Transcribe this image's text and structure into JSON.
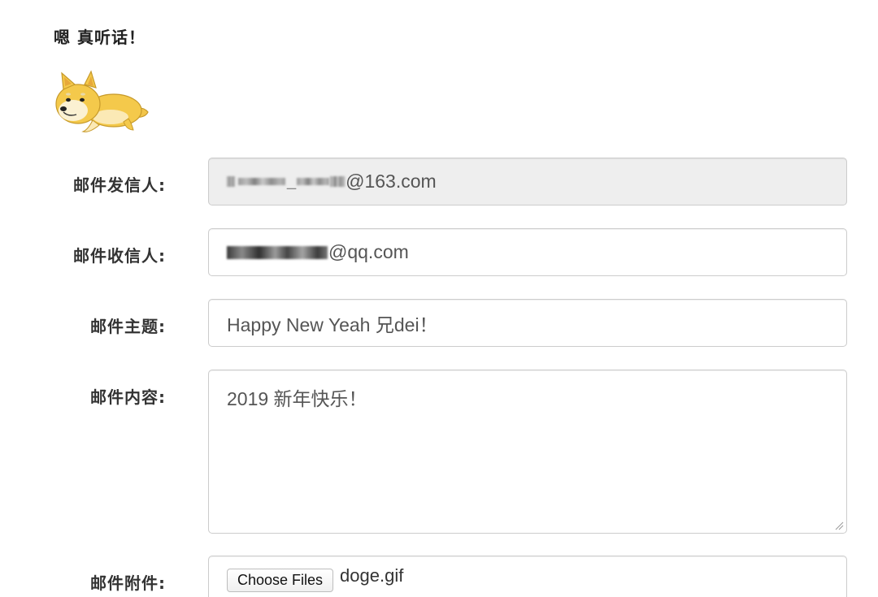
{
  "header": {
    "text": "嗯 真听话！"
  },
  "form": {
    "sender": {
      "label": "邮件发信人:",
      "value_suffix": "@163.com"
    },
    "recipient": {
      "label": "邮件收信人:",
      "value_suffix": "@qq.com"
    },
    "subject": {
      "label": "邮件主题:",
      "value": "Happy New Yeah 兄dei！"
    },
    "content": {
      "label": "邮件内容:",
      "value": "2019 新年快乐！"
    },
    "attachment": {
      "label": "邮件附件:",
      "button_label": "Choose Files",
      "file_name": "doge.gif"
    }
  },
  "icons": {
    "doge": "doge-image",
    "resize": "resize-grip-icon"
  },
  "colors": {
    "readonly_bg": "#eeeeee",
    "border": "#cccccc",
    "doge_yellow": "#f4c94b"
  }
}
